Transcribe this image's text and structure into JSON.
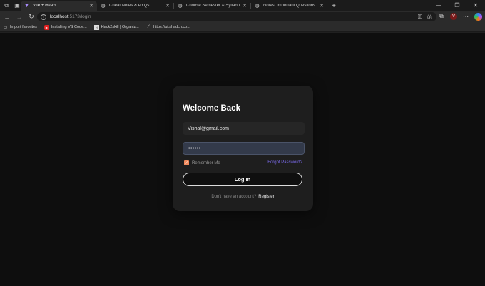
{
  "browser": {
    "tabs": [
      {
        "title": "Vite + React",
        "icon": "vite-icon",
        "active": true
      },
      {
        "title": "Cheat Notes & PYQs",
        "icon": "globe-icon",
        "active": false
      },
      {
        "title": "Choose Semester & Syllabus",
        "icon": "globe-icon",
        "active": false
      },
      {
        "title": "Notes, Important Questions & Vi",
        "icon": "globe-icon",
        "active": false
      }
    ],
    "url_host": "localhost",
    "url_path": ":5173/login",
    "bookmarks": [
      {
        "label": "Import favorites",
        "icon": "folder-icon"
      },
      {
        "label": "Installing VS Code...",
        "icon": "youtube-icon"
      },
      {
        "label": "Hack2skill | Organiz...",
        "icon": "h2s-icon"
      },
      {
        "label": "https://ui.shadcn.co...",
        "icon": "shadcn-icon"
      }
    ]
  },
  "login": {
    "title": "Welcome Back",
    "email_value": "Vishal@gmail.com",
    "password_value": "••••••",
    "remember_label": "Remember Me",
    "remember_checked": true,
    "forgot_label": "Forgot Password?",
    "button_label": "Log In",
    "signup_prompt": "Don't have an account?",
    "register_label": "Register"
  },
  "colors": {
    "accent_link": "#7c6cf0",
    "checkbox": "#f08a5d",
    "card_bg": "#1e1e1e",
    "page_bg": "#0e0e0e"
  }
}
